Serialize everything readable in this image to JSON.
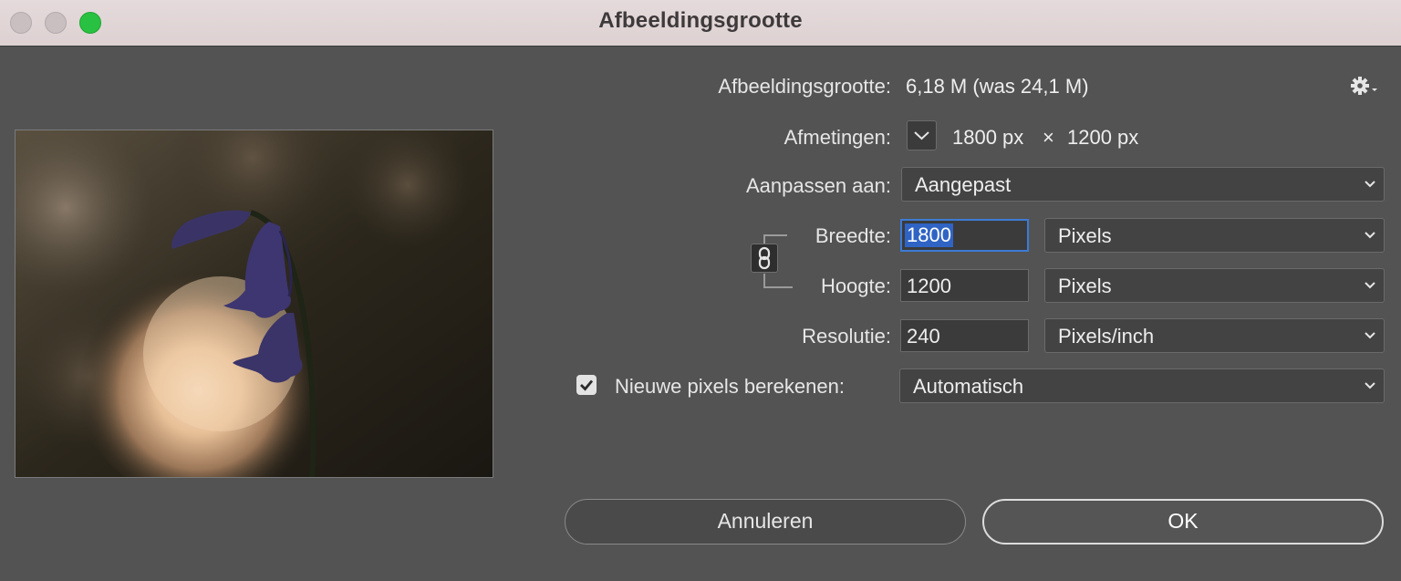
{
  "window": {
    "title": "Afbeeldingsgrootte"
  },
  "image_size": {
    "label": "Afbeeldingsgrootte:",
    "value": "6,18 M (was 24,1 M)"
  },
  "dimensions": {
    "label": "Afmetingen:",
    "width_value": "1800 px",
    "times": "×",
    "height_value": "1200 px"
  },
  "fit_to": {
    "label": "Aanpassen aan:",
    "selected": "Aangepast"
  },
  "width": {
    "label": "Breedte:",
    "value": "1800",
    "unit": "Pixels"
  },
  "height": {
    "label": "Hoogte:",
    "value": "1200",
    "unit": "Pixels"
  },
  "resolution": {
    "label": "Resolutie:",
    "value": "240",
    "unit": "Pixels/inch"
  },
  "resample": {
    "label": "Nieuwe pixels berekenen:",
    "checked": true,
    "selected": "Automatisch"
  },
  "buttons": {
    "cancel": "Annuleren",
    "ok": "OK"
  },
  "icons": {
    "settings": "gear-icon",
    "dimensions_toggle": "chevron-down-icon",
    "constrain": "chain-link-icon",
    "dropdown": "chevron-down-icon"
  },
  "colors": {
    "accent": "#3d7bd5",
    "background": "#535353",
    "titlebar": "#e2d7d8",
    "zoom_button": "#29c141"
  }
}
